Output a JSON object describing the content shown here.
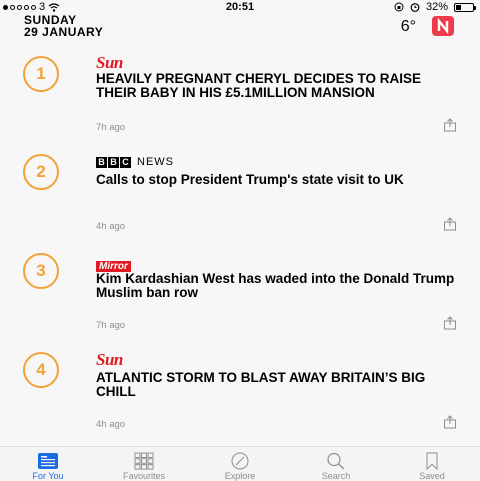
{
  "status_bar": {
    "carrier": "3",
    "time": "20:51",
    "battery": "32%",
    "battery_level": 0.32
  },
  "header": {
    "day": "SUNDAY",
    "date": "29 JANUARY",
    "temperature": "6°"
  },
  "articles": [
    {
      "rank": "1",
      "publisher": "The Sun",
      "publisher_logo_text": "Sun",
      "headline": "HEAVILY PREGNANT CHERYL DECIDES TO RAISE THEIR BABY IN HIS £5.1MILLION MANSION",
      "time": "7h ago"
    },
    {
      "rank": "2",
      "publisher": "BBC News",
      "publisher_logo_text": [
        "B",
        "B",
        "C",
        "NEWS"
      ],
      "headline": "Calls to stop President Trump's state visit to UK",
      "time": "4h ago"
    },
    {
      "rank": "3",
      "publisher": "Mirror",
      "publisher_logo_text": "Mirror",
      "headline": "Kim Kardashian West has waded into the Donald Trump Muslim ban row",
      "time": "7h ago"
    },
    {
      "rank": "4",
      "publisher": "The Sun",
      "publisher_logo_text": "Sun",
      "headline": "ATLANTIC STORM TO BLAST AWAY BRITAIN’S BIG CHILL",
      "time": "4h ago"
    }
  ],
  "tabs": [
    {
      "label": "For You",
      "icon": "for-you-icon",
      "active": true
    },
    {
      "label": "Favourites",
      "icon": "favourites-grid-icon",
      "active": false
    },
    {
      "label": "Explore",
      "icon": "compass-icon",
      "active": false
    },
    {
      "label": "Search",
      "icon": "search-icon",
      "active": false
    },
    {
      "label": "Saved",
      "icon": "bookmark-icon",
      "active": false
    }
  ],
  "colors": {
    "rank_accent": "#f2a238",
    "active_tab": "#1a6ce6",
    "inactive_tab": "#8e8e93",
    "news_icon": "#f03a4b"
  }
}
